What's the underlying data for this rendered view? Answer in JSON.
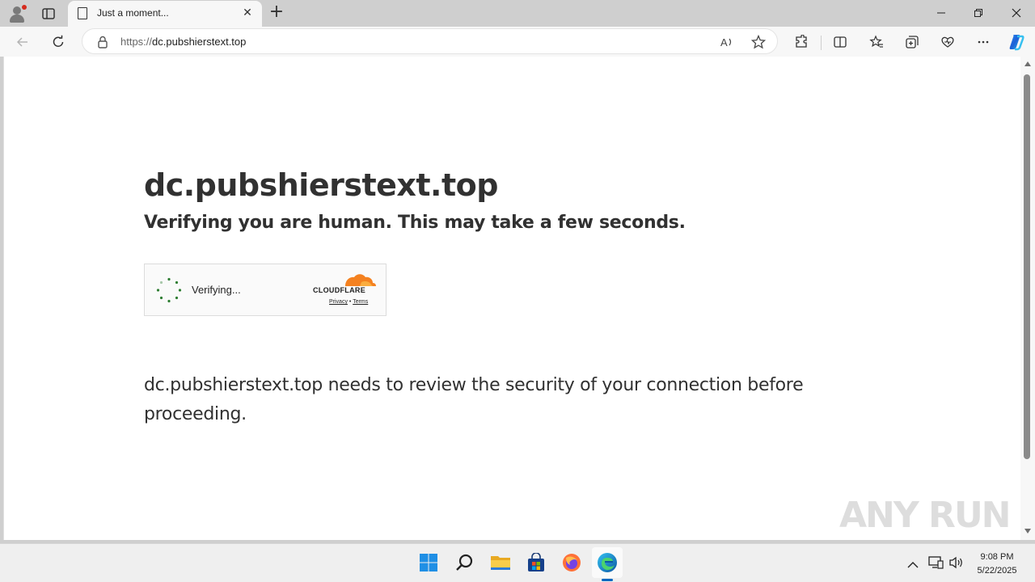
{
  "browser": {
    "tab": {
      "title": "Just a moment..."
    },
    "address": {
      "scheme": "https://",
      "host": "dc.pubshierstext.top"
    }
  },
  "page": {
    "heading": "dc.pubshierstext.top",
    "subheading": "Verifying you are human. This may take a few seconds.",
    "challenge": {
      "status": "Verifying...",
      "brand": "CLOUDFLARE",
      "privacy_link": "Privacy",
      "separator": "•",
      "terms_link": "Terms"
    },
    "paragraph": "dc.pubshierstext.top needs to review the security of your connection before proceeding."
  },
  "watermark": "ANY RUN",
  "taskbar": {
    "apps": [
      "start-icon",
      "search-icon",
      "file-explorer-icon",
      "store-icon",
      "firefox-icon",
      "edge-icon"
    ],
    "clock": {
      "time": "9:08 PM",
      "date": "5/22/2025"
    }
  },
  "colors": {
    "cloudflare_orange": "#f48120",
    "spinner_green": "#2e7d32",
    "accent": "#0067c0"
  }
}
